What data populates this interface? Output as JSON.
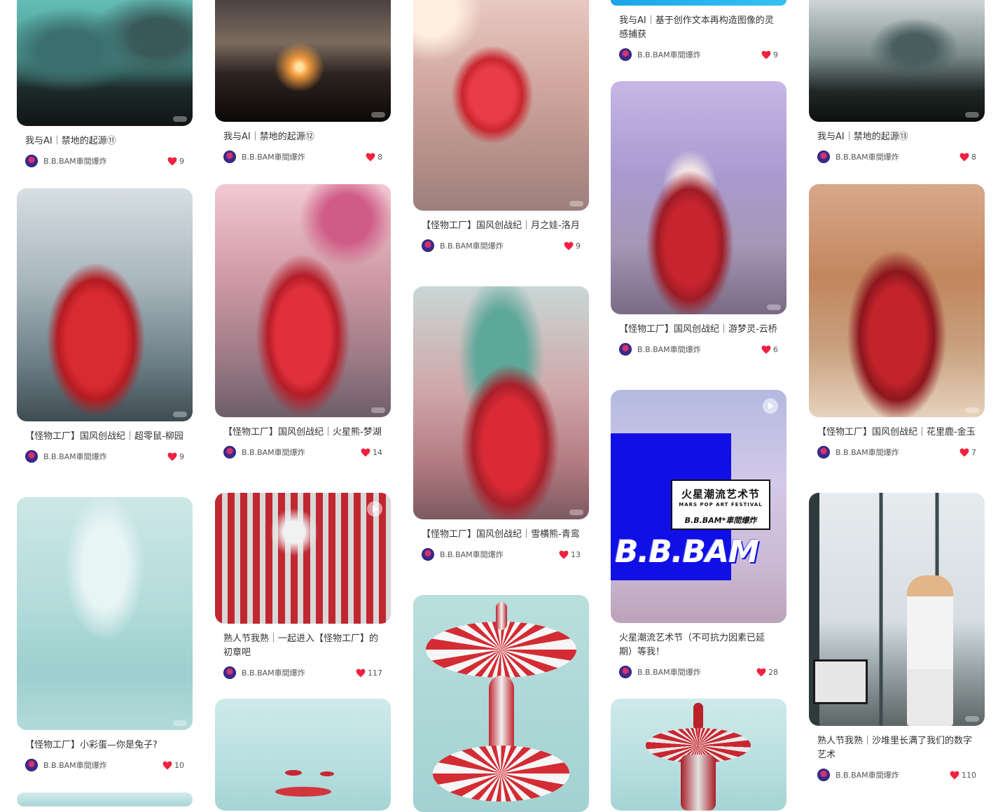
{
  "colors": {
    "heart": "#f0223f",
    "text": "#333333",
    "meta_text": "#555555"
  },
  "poster": {
    "title_cn": "火星潮流艺术节",
    "title_en": "MARS POP ART FESTIVAL",
    "brand": "B.B.BAM*車間爆炸",
    "big_text": "B.B.BAM"
  },
  "cards": [
    {
      "id": 0,
      "title": "我与AI｜禁地的起源⑪",
      "author": "B.B.BAM車間爆炸",
      "likes": "9",
      "image": "teal-wasteland-icon"
    },
    {
      "id": 1,
      "title": "我与AI｜禁地的起源⑫",
      "author": "B.B.BAM車間爆炸",
      "likes": "8",
      "image": "dusk-factory-icon"
    },
    {
      "id": 2,
      "title": "【怪物工厂】国风创战纪｜月之娃-洛月",
      "author": "B.B.BAM車間爆炸",
      "likes": "9",
      "image": "red-doll-icon"
    },
    {
      "id": 3,
      "title": "我与AI｜基于创作文本再构造图像的灵感捕获",
      "author": "B.B.BAM車間爆炸",
      "likes": "9",
      "image": ""
    },
    {
      "id": 4,
      "title": "我与AI｜禁地的起源⑬",
      "author": "B.B.BAM車間爆炸",
      "likes": "8",
      "image": "garbage-field-icon"
    },
    {
      "id": 5,
      "title": "【怪物工厂】国风创战纪｜超零鼠-柳园",
      "author": "B.B.BAM車間爆炸",
      "likes": "9",
      "image": "red-rat-icon"
    },
    {
      "id": 6,
      "title": "【怪物工厂】国风创战纪｜火星熊-梦湖",
      "author": "B.B.BAM車間爆炸",
      "likes": "14",
      "image": "red-bear-icon"
    },
    {
      "id": 7,
      "title": "【怪物工厂】国风创战纪｜游梦灵-云桥",
      "author": "B.B.BAM車間爆炸",
      "likes": "6",
      "image": "dream-spirit-icon"
    },
    {
      "id": 8,
      "title": "【怪物工厂】国风创战纪｜花里鹿-金玉",
      "author": "B.B.BAM車間爆炸",
      "likes": "7",
      "image": "red-deer-icon"
    },
    {
      "id": 9,
      "title": "【怪物工厂】国风创战纪｜雪横熊-青鸾",
      "author": "B.B.BAM車間爆炸",
      "likes": "13",
      "image": "snow-bear-icon"
    },
    {
      "id": 10,
      "title": "火星潮流艺术节（不可抗力因素已延期）等我！",
      "author": "B.B.BAM車間爆炸",
      "likes": "28",
      "image": "festival-poster-icon"
    },
    {
      "id": 11,
      "title": "【怪物工厂】小彩蛋—你是兔子?",
      "author": "B.B.BAM車間爆炸",
      "likes": "10",
      "image": "jelly-tower-icon"
    },
    {
      "id": 12,
      "title": "熟人节我熟｜一起进入【怪物工厂】的初章吧",
      "author": "B.B.BAM車間爆炸",
      "likes": "117",
      "image": "red-machine-icon"
    },
    {
      "id": 13,
      "title": "熟人节我熟｜沙堆里长满了我们的数字艺术",
      "author": "B.B.BAM車間爆炸",
      "likes": "110",
      "image": "exhibition-photo-icon"
    }
  ]
}
